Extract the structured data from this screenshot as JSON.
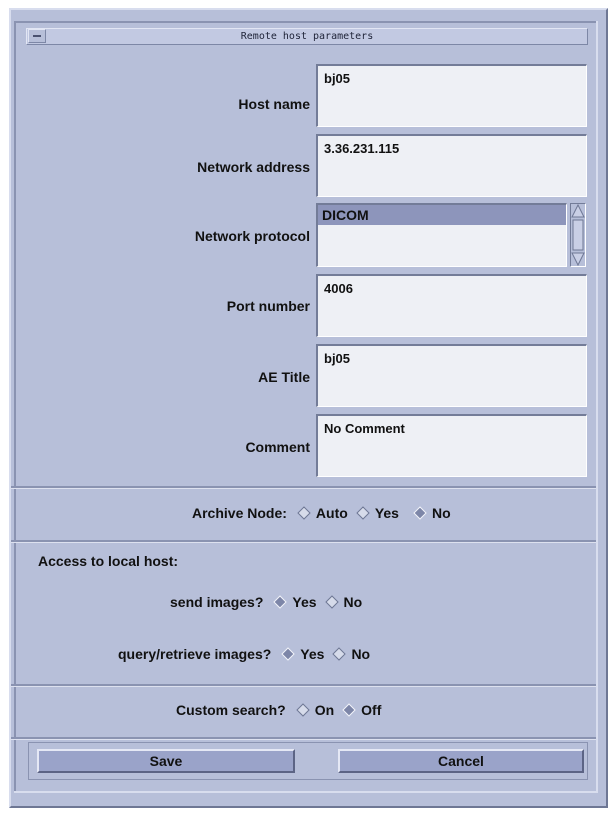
{
  "window": {
    "title": "Remote host parameters"
  },
  "fields": {
    "host_name": {
      "label": "Host name",
      "value": "bj05"
    },
    "network_address": {
      "label": "Network address",
      "value": "3.36.231.115"
    },
    "network_protocol": {
      "label": "Network protocol",
      "options": [
        "DICOM"
      ],
      "selected": "DICOM"
    },
    "port_number": {
      "label": "Port number",
      "value": "4006"
    },
    "ae_title": {
      "label": "AE Title",
      "value": "bj05"
    },
    "comment": {
      "label": "Comment",
      "value": "No Comment"
    }
  },
  "archive_node": {
    "label": "Archive Node:",
    "options": [
      "Auto",
      "Yes",
      "No"
    ],
    "selected": "No"
  },
  "access": {
    "heading": "Access to local host:",
    "send_images": {
      "label": "send images?",
      "options": [
        "Yes",
        "No"
      ],
      "selected": "Yes"
    },
    "query_retrieve": {
      "label": "query/retrieve images?",
      "options": [
        "Yes",
        "No"
      ],
      "selected": "Yes"
    }
  },
  "custom_search": {
    "label": "Custom search?",
    "options": [
      "On",
      "Off"
    ],
    "selected": "Off"
  },
  "buttons": {
    "save": "Save",
    "cancel": "Cancel"
  },
  "colors": {
    "background": "#b7bfd9",
    "field": "#eef0f5",
    "selection": "#8d95bb",
    "button": "#9aa3c9"
  }
}
